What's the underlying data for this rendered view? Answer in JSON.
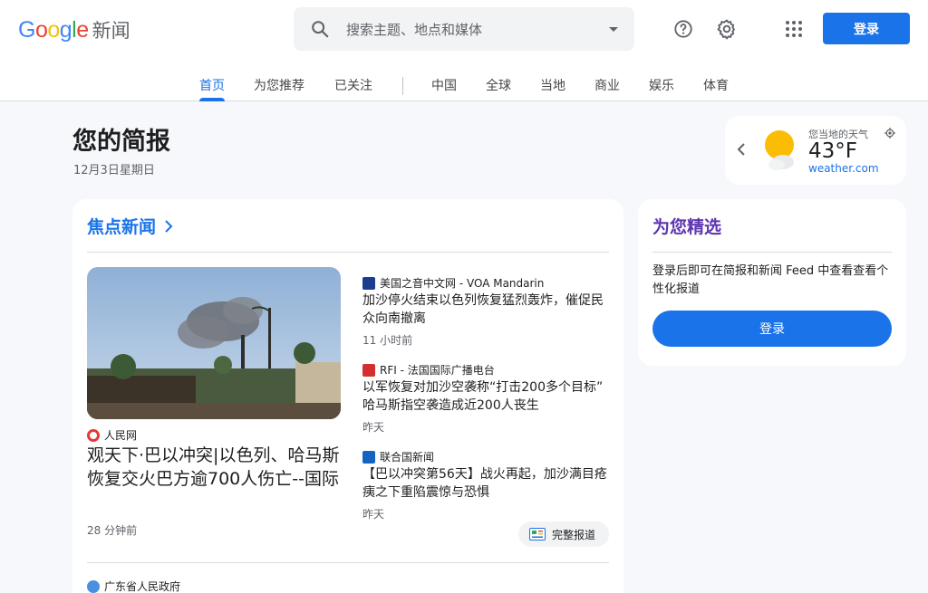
{
  "header": {
    "logo_word": "Google",
    "logo_suffix": "新闻",
    "search_placeholder": "搜索主题、地点和媒体",
    "signin_label": "登录",
    "help_icon": "help-icon",
    "settings_icon": "gear-icon",
    "apps_icon": "apps-grid-icon"
  },
  "tabs": [
    {
      "label": "首页",
      "active": true
    },
    {
      "label": "为您推荐"
    },
    {
      "label": "已关注"
    },
    {
      "label": "中国"
    },
    {
      "label": "全球"
    },
    {
      "label": "当地"
    },
    {
      "label": "商业"
    },
    {
      "label": "娱乐"
    },
    {
      "label": "体育"
    }
  ],
  "briefing": {
    "title": "您的简报",
    "date": "12月3日星期日"
  },
  "weather": {
    "location_label": "您当地的天气",
    "temperature": "43°F",
    "source": "weather.com",
    "icon": "partly-sunny-icon"
  },
  "top_stories": {
    "heading": "焦点新闻",
    "hero": {
      "publisher": "人民网",
      "headline": "观天下·巴以冲突|以色列、哈马斯恢复交火巴方逾700人伤亡--国际",
      "time": "28 分钟前"
    },
    "side": [
      {
        "publisher": "美国之音中文网 - VOA Mandarin",
        "headline": "加沙停火结束以色列恢复猛烈轰炸，催促民众向南撤离",
        "time": "11 小时前"
      },
      {
        "publisher": "RFI - 法国国际广播电台",
        "headline": "以军恢复对加沙空袭称“打击200多个目标” 哈马斯指空袭造成近200人丧生",
        "time": "昨天"
      },
      {
        "publisher": "联合国新闻",
        "headline": "【巴以冲突第56天】战火再起，加沙满目疮痍之下重陷震惊与恐惧",
        "time": "昨天"
      }
    ],
    "full_coverage": "完整报道",
    "next_publisher": "广东省人民政府"
  },
  "for_you": {
    "heading": "为您精选",
    "description": "登录后即可在简报和新闻 Feed 中查看查看个性化报道",
    "button": "登录"
  }
}
